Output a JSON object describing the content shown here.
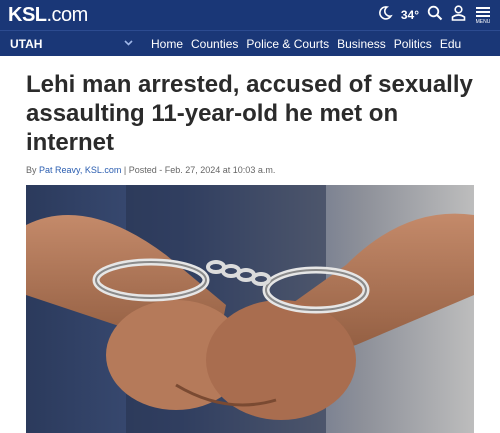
{
  "header": {
    "logo_main": "KSL",
    "logo_suffix": ".com",
    "temperature": "34°",
    "menu_label": "MENU",
    "icons": [
      "moon-icon",
      "search-icon",
      "user-icon",
      "menu-icon"
    ]
  },
  "nav": {
    "region": "UTAH",
    "items": [
      "Home",
      "Counties",
      "Police & Courts",
      "Business",
      "Politics",
      "Edu"
    ]
  },
  "article": {
    "headline": "Lehi man arrested, accused of sexually assaulting 11-year-old he met on internet",
    "byline_prefix": "By ",
    "author": "Pat Reavy, KSL.com",
    "posted": " | Posted - Feb. 27, 2024 at 10:03 a.m."
  },
  "colors": {
    "brand": "#1a3777",
    "link": "#2a5db0"
  }
}
